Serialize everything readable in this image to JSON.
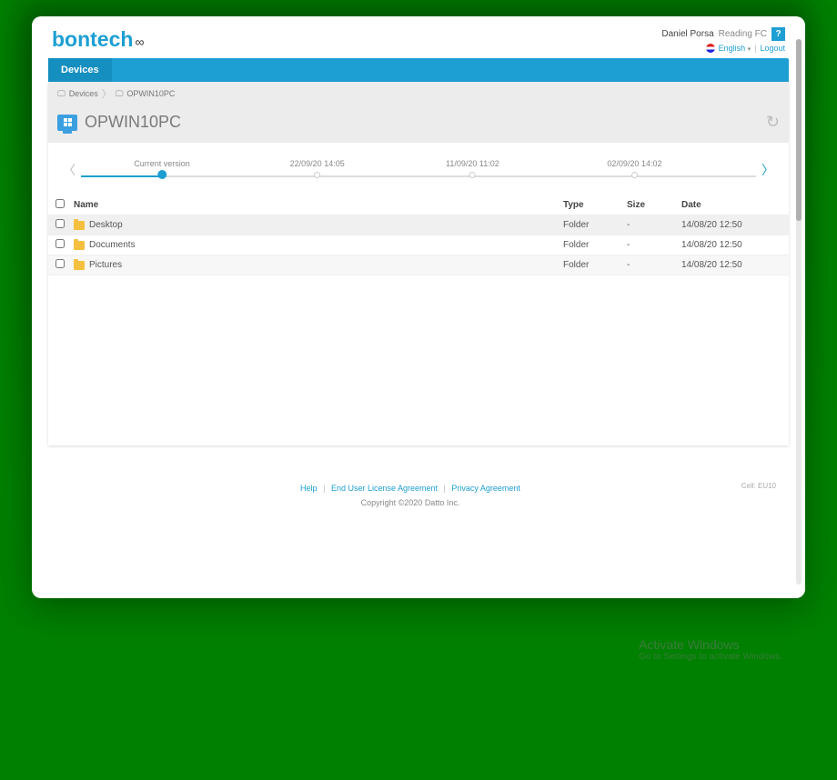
{
  "header": {
    "logo_text": "bontech",
    "user_name": "Daniel Porsa",
    "team_name": "Reading FC",
    "help_label": "?",
    "language": "English",
    "logout_label": "Logout"
  },
  "nav": {
    "tab_devices": "Devices"
  },
  "breadcrumb": {
    "root": "Devices",
    "current": "OPWIN10PC"
  },
  "device": {
    "title": "OPWIN10PC"
  },
  "timeline": {
    "points": [
      {
        "label": "Current version",
        "pos": 12,
        "active": true
      },
      {
        "label": "22/09/20 14:05",
        "pos": 35,
        "active": false
      },
      {
        "label": "11/09/20 11:02",
        "pos": 58,
        "active": false
      },
      {
        "label": "02/09/20 14:02",
        "pos": 82,
        "active": false
      }
    ]
  },
  "table": {
    "headers": {
      "name": "Name",
      "type": "Type",
      "size": "Size",
      "date": "Date"
    },
    "rows": [
      {
        "name": "Desktop",
        "type": "Folder",
        "size": "-",
        "date": "14/08/20 12:50"
      },
      {
        "name": "Documents",
        "type": "Folder",
        "size": "-",
        "date": "14/08/20 12:50"
      },
      {
        "name": "Pictures",
        "type": "Folder",
        "size": "-",
        "date": "14/08/20 12:50"
      }
    ]
  },
  "footer": {
    "help": "Help",
    "eula": "End User License Agreement",
    "privacy": "Privacy Agreement",
    "copyright": "Copyright ©2020 Datto Inc.",
    "cell": "Cell: EU10"
  },
  "watermark": {
    "line1": "Activate Windows",
    "line2": "Go to Settings to activate Windows."
  }
}
